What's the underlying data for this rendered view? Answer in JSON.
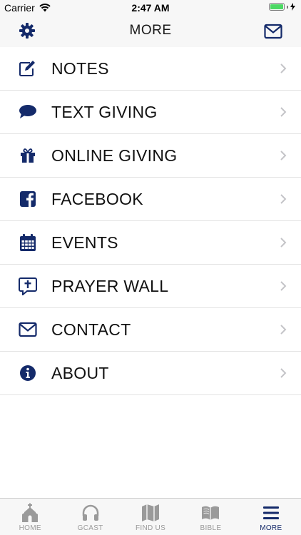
{
  "status": {
    "carrier": "Carrier",
    "time": "2:47 AM"
  },
  "nav": {
    "title": "MORE",
    "left_icon": "gear-icon",
    "right_icon": "envelope-icon"
  },
  "menu": [
    {
      "label": "NOTES",
      "icon": "edit-icon"
    },
    {
      "label": "TEXT GIVING",
      "icon": "chat-bubble-icon"
    },
    {
      "label": "ONLINE GIVING",
      "icon": "gift-icon"
    },
    {
      "label": "FACEBOOK",
      "icon": "facebook-icon"
    },
    {
      "label": "EVENTS",
      "icon": "calendar-icon"
    },
    {
      "label": "PRAYER WALL",
      "icon": "prayer-cross-icon"
    },
    {
      "label": "CONTACT",
      "icon": "envelope-icon"
    },
    {
      "label": "ABOUT",
      "icon": "info-icon"
    }
  ],
  "tabs": [
    {
      "label": "HOME",
      "icon": "church-icon",
      "active": false
    },
    {
      "label": "GCAST",
      "icon": "headphones-icon",
      "active": false
    },
    {
      "label": "FIND US",
      "icon": "map-icon",
      "active": false
    },
    {
      "label": "BIBLE",
      "icon": "book-icon",
      "active": false
    },
    {
      "label": "MORE",
      "icon": "menu-icon",
      "active": true
    }
  ],
  "colors": {
    "accent": "#142a6a",
    "tab_inactive": "#9a9a9a",
    "separator": "#e3e3e3"
  }
}
